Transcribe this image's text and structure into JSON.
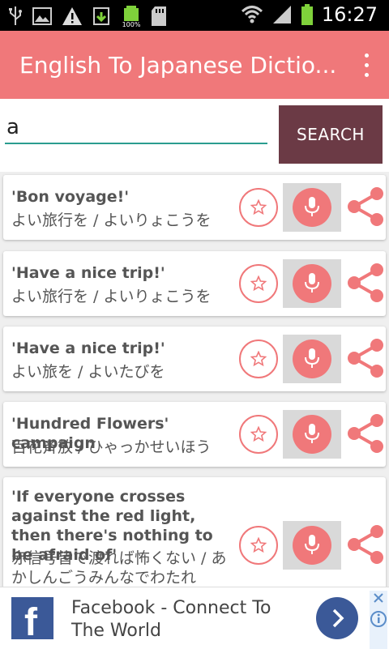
{
  "status_bar": {
    "time": "16:27",
    "battery_label": "100%",
    "icons": [
      "usb-icon",
      "image-icon",
      "warning-icon",
      "download-icon",
      "battery-full-icon",
      "sd-card-icon",
      "wifi-icon",
      "signal-icon",
      "battery-icon"
    ]
  },
  "app_bar": {
    "title": "English To Japanese Dictio...",
    "menu_icon": "overflow-menu-icon"
  },
  "search": {
    "value": "a",
    "placeholder": "",
    "button_label": "SEARCH"
  },
  "results": [
    {
      "english": "'Bon voyage!'",
      "japanese": "よい旅行を / よいりょこうを"
    },
    {
      "english": "'Have a nice trip!'",
      "japanese": "よい旅行を / よいりょこうを"
    },
    {
      "english": "'Have a nice trip!'",
      "japanese": "よい旅を / よいたびを"
    },
    {
      "english": "'Hundred Flowers' campaign",
      "japanese": "百花斉放 / ひゃっかせいほう"
    },
    {
      "english": "'If everyone crosses against the red light, then there's nothing to be afraid of'",
      "japanese": "赤信号皆で渡れば怖くない / あかしんごうみんなでわたれ"
    }
  ],
  "ad": {
    "logo_letter": "f",
    "text": "Facebook - Connect To The World",
    "arrow": "›"
  },
  "colors": {
    "accent": "#f0787a",
    "search_button": "#6b3a45",
    "input_underline": "#2a9d8f"
  }
}
